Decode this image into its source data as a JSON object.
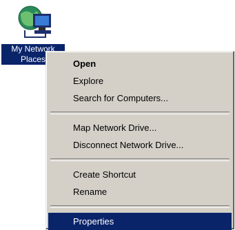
{
  "desktop_icon": {
    "label_line1": "My Network",
    "label_line2": "Places",
    "icon_name": "network-computer-icon"
  },
  "context_menu": {
    "items": [
      {
        "label": "Open"
      },
      {
        "label": "Explore"
      },
      {
        "label": "Search for Computers..."
      },
      {
        "label": "Map Network Drive..."
      },
      {
        "label": "Disconnect Network Drive..."
      },
      {
        "label": "Create Shortcut"
      },
      {
        "label": "Rename"
      },
      {
        "label": "Properties"
      }
    ]
  },
  "colors": {
    "menu_background": "#d4d0c8",
    "selection": "#0a246a",
    "selection_text": "#ffffff"
  }
}
